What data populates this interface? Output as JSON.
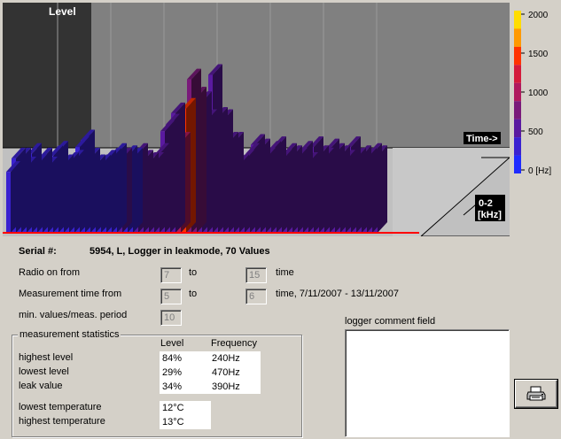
{
  "chart": {
    "level_label": "Level",
    "time_label": "Time->",
    "freq_label_top": "0-2",
    "freq_label_bottom": "[kHz]",
    "type": "3d-bar",
    "level_percent": [
      27,
      33,
      33,
      29,
      35,
      30,
      33,
      29,
      34,
      36,
      30,
      31,
      32,
      38,
      41,
      33,
      30,
      30,
      32,
      33,
      35,
      33,
      34,
      33,
      35,
      32,
      31,
      31,
      35,
      45,
      48,
      53,
      40,
      55,
      68,
      60,
      58,
      50,
      70,
      51,
      50,
      40,
      40,
      30,
      32,
      35,
      39,
      37,
      33,
      36,
      38,
      32,
      35,
      34,
      33,
      36,
      31,
      38,
      34,
      33,
      37,
      35,
      34,
      32,
      38,
      33,
      34,
      33,
      35,
      34
    ],
    "frequency_hz": [
      300,
      320,
      340,
      330,
      350,
      310,
      330,
      340,
      320,
      350,
      360,
      340,
      330,
      350,
      360,
      340,
      330,
      320,
      340,
      360,
      370,
      380,
      360,
      350,
      390,
      380,
      400,
      420,
      440,
      520,
      560,
      600,
      900,
      1400,
      700,
      650,
      600,
      560,
      620,
      580,
      560,
      540,
      500,
      480,
      460,
      470,
      480,
      460,
      450,
      470,
      480,
      460,
      450,
      470,
      480,
      460,
      450,
      470,
      480,
      460,
      450,
      470,
      460,
      450,
      480,
      460,
      470,
      450,
      460,
      470
    ]
  },
  "color_scale": {
    "unit": "[Hz]",
    "ticks": [
      "2000",
      "1500",
      "1000",
      "500",
      "0"
    ],
    "colors": [
      "#ffdd00",
      "#ff9900",
      "#ff3300",
      "#d41b3c",
      "#b01a5e",
      "#7a1a7a",
      "#5a1aa0",
      "#3a22d0",
      "#1f2bff"
    ]
  },
  "serial": {
    "label": "Serial #:",
    "value": "5954, L, Logger in leakmode, 70 Values"
  },
  "radio_on": {
    "label": "Radio on from",
    "from": "7",
    "to_label": "to",
    "to": "15",
    "unit": "time"
  },
  "measurement_time": {
    "label": "Measurement time from",
    "from": "5",
    "to_label": "to",
    "to": "6",
    "unit": "time, 7/11/2007 - 13/11/2007"
  },
  "min_values": {
    "label": "min. values/meas. period",
    "value": "10"
  },
  "statistics": {
    "title": "measurement statistics",
    "col_level": "Level",
    "col_frequency": "Frequency",
    "highest_level_label": "highest level",
    "highest_level": "84%",
    "highest_level_freq": "240Hz",
    "lowest_level_label": "lowest level",
    "lowest_level": "29%",
    "lowest_level_freq": "470Hz",
    "leak_value_label": "leak value",
    "leak_value": "34%",
    "leak_value_freq": "390Hz",
    "lowest_temp_label": "lowest temperature",
    "lowest_temp": "12°C",
    "highest_temp_label": "highest temperature",
    "highest_temp": "13°C"
  },
  "comment": {
    "label": "logger comment field",
    "value": ""
  },
  "print_button": {
    "icon": "printer-icon"
  }
}
